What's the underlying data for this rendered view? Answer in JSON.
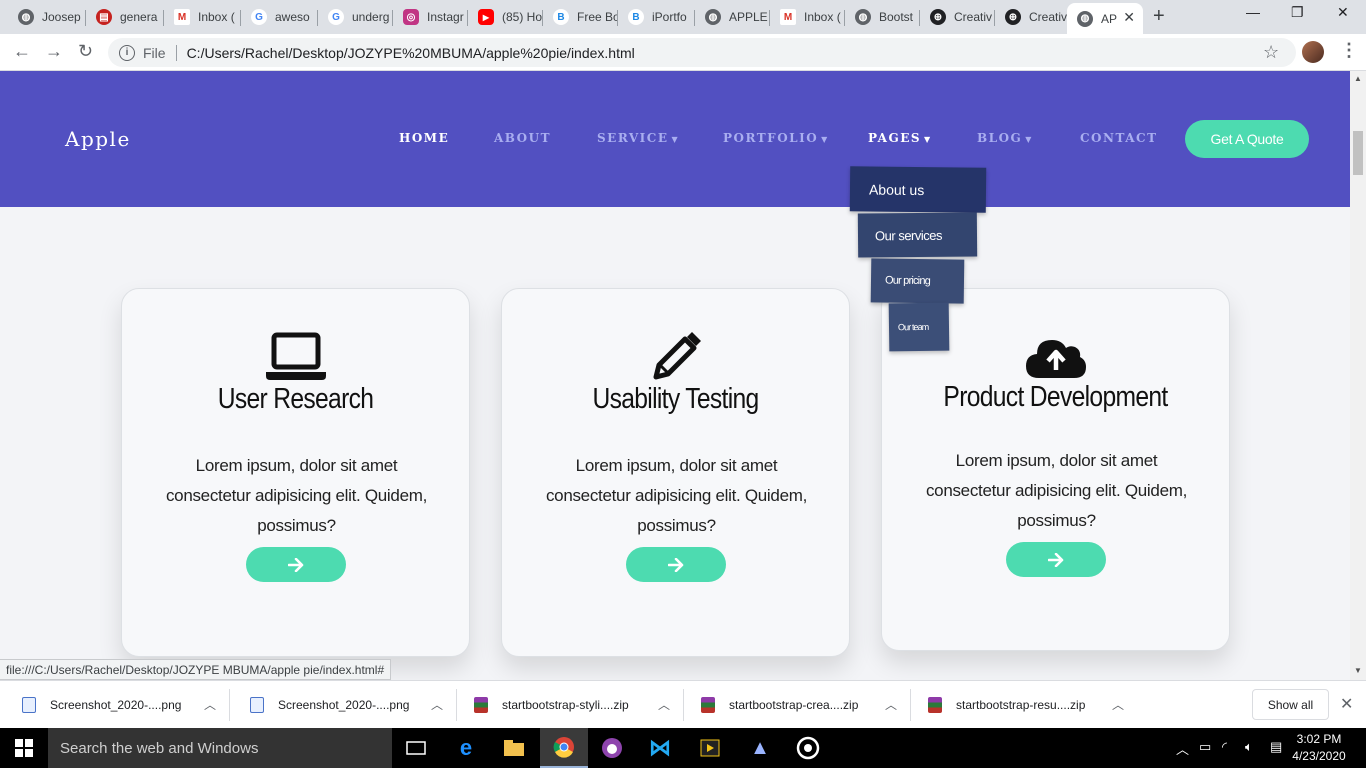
{
  "browser": {
    "tabs": [
      {
        "label": "Joosep",
        "icon": "globe-icon",
        "color": "#5f6368"
      },
      {
        "label": "genera",
        "icon": "book-icon",
        "color": "#c5221f"
      },
      {
        "label": "Inbox (",
        "icon": "gmail-icon",
        "color": "#d93025"
      },
      {
        "label": "aweso",
        "icon": "google-icon",
        "color": "#4285f4"
      },
      {
        "label": "underg",
        "icon": "google-icon",
        "color": "#4285f4"
      },
      {
        "label": "Instagr",
        "icon": "instagram-icon",
        "color": "#c13584"
      },
      {
        "label": "(85) Ho",
        "icon": "youtube-icon",
        "color": "#ff0000"
      },
      {
        "label": "Free Bo",
        "icon": "bootstrap-icon",
        "color": "#1e88e5"
      },
      {
        "label": "iPortfo",
        "icon": "bootstrap-icon",
        "color": "#1e88e5"
      },
      {
        "label": "APPLE",
        "icon": "globe-icon",
        "color": "#5f6368"
      },
      {
        "label": "Inbox (",
        "icon": "gmail-icon",
        "color": "#d93025"
      },
      {
        "label": "Bootst",
        "icon": "globe-icon",
        "color": "#5f6368"
      },
      {
        "label": "Creativ",
        "icon": "world-icon",
        "color": "#202124"
      },
      {
        "label": "Creativ",
        "icon": "world-icon",
        "color": "#202124"
      },
      {
        "label": "AP",
        "icon": "globe-icon",
        "color": "#5f6368",
        "active": true
      }
    ],
    "address": {
      "protocol_label": "File",
      "url": "C:/Users/Rachel/Desktop/JOZYPE%20MBUMA/apple%20pie/index.html"
    },
    "status_url": "file:///C:/Users/Rachel/Desktop/JOZYPE MBUMA/apple pie/index.html#"
  },
  "site": {
    "brand": "Apple",
    "nav": [
      {
        "label": "HOME",
        "active": true,
        "caret": false
      },
      {
        "label": "ABOUT",
        "caret": false
      },
      {
        "label": "SERVICE",
        "caret": true
      },
      {
        "label": "PORTFOLIO",
        "caret": true
      },
      {
        "label": "PAGES",
        "caret": true
      },
      {
        "label": "BLOG",
        "caret": true
      },
      {
        "label": "CONTACT",
        "caret": false
      }
    ],
    "cta": "Get A Quote",
    "pages_dropdown": [
      "About us",
      "Our services",
      "Our pricing",
      "Our team"
    ],
    "cards": [
      {
        "icon": "laptop-icon",
        "title": "User Research",
        "text": "Lorem ipsum, dolor sit amet consectetur adipisicing elit. Quidem, possimus?"
      },
      {
        "icon": "pencil-icon",
        "title": "Usability Testing",
        "text": "Lorem ipsum, dolor sit amet consectetur adipisicing elit. Quidem, possimus?"
      },
      {
        "icon": "cloud-upload-icon",
        "title": "Product Development",
        "text": "Lorem ipsum, dolor sit amet consectetur adipisicing elit. Quidem, possimus?"
      }
    ],
    "colors": {
      "hero": "#5250c1",
      "accent": "#4ddbb0",
      "dropdown": "#26356e"
    }
  },
  "downloads": {
    "items": [
      {
        "label": "Screenshot_2020-....png",
        "icon": "image-file-icon"
      },
      {
        "label": "Screenshot_2020-....png",
        "icon": "image-file-icon"
      },
      {
        "label": "startbootstrap-styli....zip",
        "icon": "zip-file-icon"
      },
      {
        "label": "startbootstrap-crea....zip",
        "icon": "zip-file-icon"
      },
      {
        "label": "startbootstrap-resu....zip",
        "icon": "zip-file-icon"
      }
    ],
    "show_all": "Show all"
  },
  "taskbar": {
    "search_placeholder": "Search the web and Windows",
    "time": "3:02 PM",
    "date": "4/23/2020"
  }
}
